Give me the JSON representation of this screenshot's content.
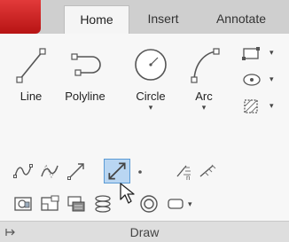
{
  "tabs": [
    {
      "label": "Home",
      "active": true
    },
    {
      "label": "Insert",
      "active": false
    },
    {
      "label": "Annotate",
      "active": false
    }
  ],
  "draw_panel": {
    "title": "Draw",
    "tools": [
      {
        "label": "Line",
        "icon": "line-icon"
      },
      {
        "label": "Polyline",
        "icon": "polyline-icon"
      },
      {
        "label": "Circle",
        "icon": "circle-icon",
        "has_dropdown": true
      },
      {
        "label": "Arc",
        "icon": "arc-icon",
        "has_dropdown": true
      }
    ],
    "dropdown_arrow": "▾",
    "small_tools": [
      "rectangle-icon",
      "ellipse-icon",
      "hatch-icon"
    ],
    "expanded_row1": [
      "spline-fit-icon",
      "spline-cv-icon",
      "ray-icon",
      "construction-line-icon",
      "point-icon",
      "divide-icon",
      "measure-icon"
    ],
    "expanded_row2": [
      "region-icon",
      "boundary-icon",
      "wipeout-icon",
      "helix-icon",
      "donut-icon",
      "revision-cloud-icon"
    ]
  },
  "colors": {
    "ribbon_tab_active": "#f5f5f5",
    "app_button": "#d12a2a",
    "highlight": "#b9d6f2"
  }
}
